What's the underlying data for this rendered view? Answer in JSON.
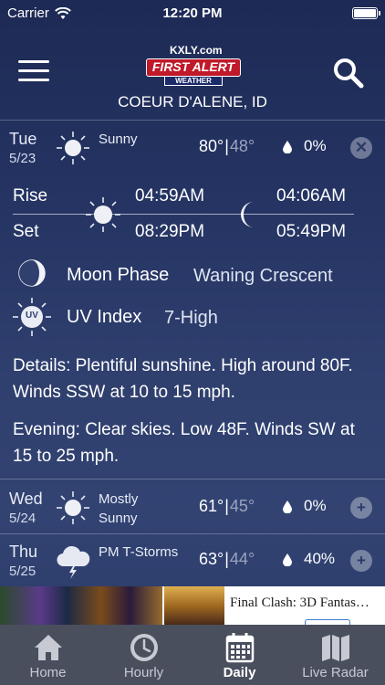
{
  "status_bar": {
    "carrier": "Carrier",
    "time": "12:20 PM"
  },
  "header": {
    "logo_top": "KXLY.com",
    "logo_main": "FIRST ALERT",
    "logo_sub": "WEATHER",
    "location": "COEUR D'ALENE, ID"
  },
  "today": {
    "day": "Tue",
    "date": "5/23",
    "icon": "sun-icon",
    "condition": "Sunny",
    "high": "80°",
    "separator": "|",
    "low": "48°",
    "precip": "0%",
    "action": "✕"
  },
  "details_panel": {
    "rise_label": "Rise",
    "set_label": "Set",
    "sunrise": "04:59AM",
    "sunset": "08:29PM",
    "moonrise": "04:06AM",
    "moonset": "05:49PM",
    "moon_phase_label": "Moon Phase",
    "moon_phase_value": "Waning Crescent",
    "uv_icon_text": "UV",
    "uv_label": "UV Index",
    "uv_value": "7-High",
    "details_text": "Details: Plentiful sunshine. High around 80F. Winds SSW at 10 to 15 mph.",
    "evening_text": "Evening: Clear skies. Low 48F. Winds SW at 15 to 25 mph."
  },
  "forecast": [
    {
      "day": "Wed",
      "date": "5/24",
      "condition": "Mostly Sunny",
      "high": "61°",
      "separator": "|",
      "low": "45°",
      "precip": "0%",
      "action": "+"
    },
    {
      "day": "Thu",
      "date": "5/25",
      "condition": "PM T-Storms",
      "high": "63°",
      "separator": "|",
      "low": "44°",
      "precip": "40%",
      "action": "+"
    }
  ],
  "ad": {
    "title": "Final Clash: 3D Fantas…"
  },
  "tabs": [
    {
      "label": "Home",
      "icon": "home-icon",
      "active": false
    },
    {
      "label": "Hourly",
      "icon": "clock-icon",
      "active": false
    },
    {
      "label": "Daily",
      "icon": "calendar-icon",
      "active": true
    },
    {
      "label": "Live Radar",
      "icon": "map-icon",
      "active": false
    }
  ],
  "colors": {
    "tab_bar": "#4a4f5e",
    "logo_red": "#c0192a",
    "background": "#2a3a69"
  }
}
